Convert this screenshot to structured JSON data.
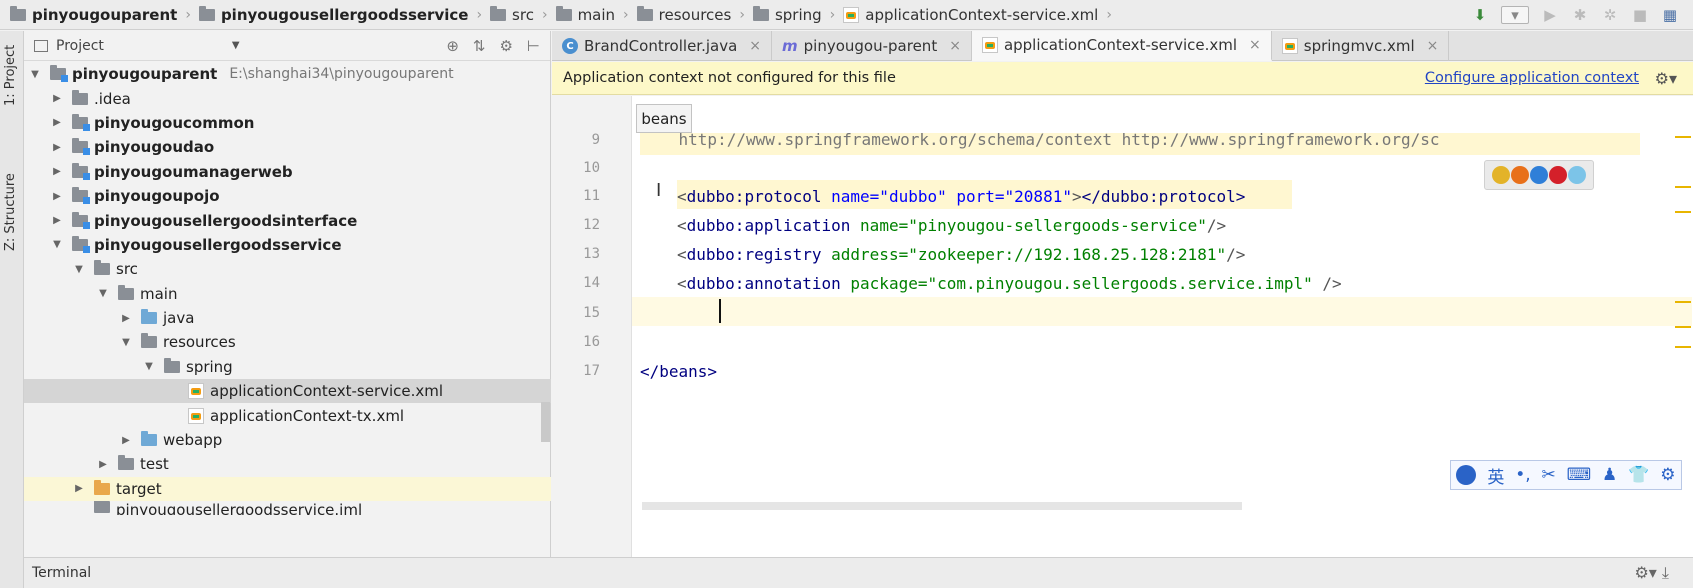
{
  "breadcrumb": {
    "items": [
      "pinyougouparent",
      "pinyougousellergoodsservice",
      "src",
      "main",
      "resources",
      "spring",
      "applicationContext-service.xml"
    ]
  },
  "left_strip": {
    "project_label": "1: Project",
    "structure_label": "Z: Structure"
  },
  "project_panel": {
    "title": "Project",
    "tree": [
      {
        "label": "pinyougouparent",
        "path": "E:\\shanghai34\\pinyougouparent",
        "bold": true
      },
      {
        "label": ".idea"
      },
      {
        "label": "pinyougoucommon",
        "bold": true
      },
      {
        "label": "pinyougoudao",
        "bold": true
      },
      {
        "label": "pinyougoumanagerweb",
        "bold": true
      },
      {
        "label": "pinyougoupojo",
        "bold": true
      },
      {
        "label": "pinyougousellergoodsinterface",
        "bold": true
      },
      {
        "label": "pinyougousellergoodsservice",
        "bold": true
      },
      {
        "label": "src"
      },
      {
        "label": "main"
      },
      {
        "label": "java"
      },
      {
        "label": "resources"
      },
      {
        "label": "spring"
      },
      {
        "label": "applicationContext-service.xml"
      },
      {
        "label": "applicationContext-tx.xml"
      },
      {
        "label": "webapp"
      },
      {
        "label": "test"
      },
      {
        "label": "target"
      },
      {
        "label": "pinyougousellergoodsservice.iml"
      }
    ]
  },
  "tabs": [
    {
      "label": "BrandController.java",
      "icon": "class-icon"
    },
    {
      "label": "pinyougou-parent",
      "icon": "maven-icon"
    },
    {
      "label": "applicationContext-service.xml",
      "icon": "xml-icon",
      "active": true
    },
    {
      "label": "springmvc.xml",
      "icon": "xml-icon"
    }
  ],
  "notice": {
    "message": "Application context not configured for this file",
    "action": "Configure application context"
  },
  "editor": {
    "tooltip": "beans",
    "lines": [
      {
        "num": "9",
        "text": "    http://www.springframework.org/schema/context http://www.springframework.org/sc"
      },
      {
        "num": "10",
        "text": ""
      },
      {
        "num": "11",
        "tag": "dubbo:protocol",
        "attrs": "name=\"dubbo\" port=\"20881\"",
        "close": "</dubbo:protocol>"
      },
      {
        "num": "12",
        "tag": "dubbo:application",
        "attrs": "name=\"pinyougou-sellergoods-service\""
      },
      {
        "num": "13",
        "tag": "dubbo:registry",
        "attrs": "address=\"zookeeper://192.168.25.128:2181\""
      },
      {
        "num": "14",
        "tag": "dubbo:annotation",
        "attrs": "package=\"com.pinyougou.sellergoods.service.impl\""
      },
      {
        "num": "15",
        "text": ""
      },
      {
        "num": "16",
        "text": ""
      },
      {
        "num": "17",
        "text": "</beans>"
      }
    ]
  },
  "ime": {
    "lang": "英"
  },
  "terminal": {
    "label": "Terminal"
  }
}
